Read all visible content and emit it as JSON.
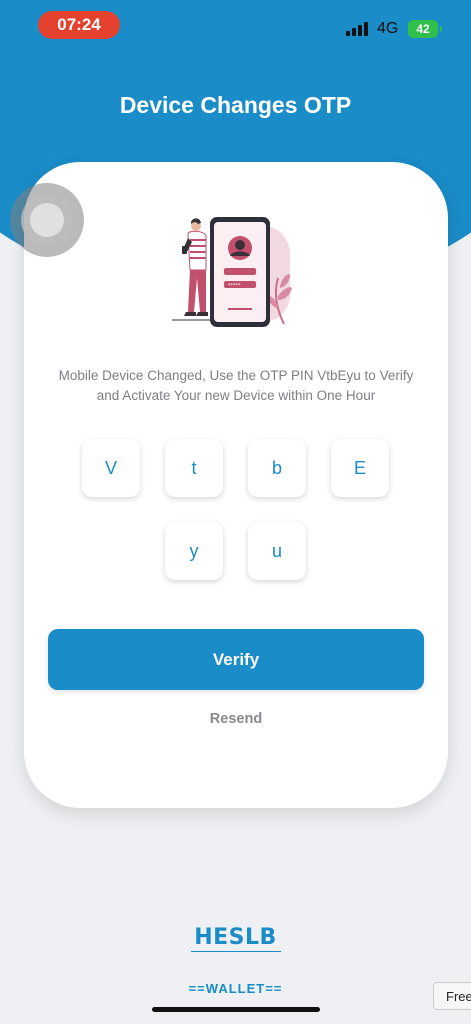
{
  "status_bar": {
    "time": "07:24",
    "network": "4G",
    "battery": "42"
  },
  "page": {
    "title": "Device Changes OTP"
  },
  "card": {
    "message": "Mobile Device Changed, Use the OTP PIN VtbEyu to Verify and Activate Your new Device within One Hour",
    "otp_digits": [
      "V",
      "t",
      "b",
      "E",
      "y",
      "u"
    ],
    "verify_label": "Verify",
    "resend_label": "Resend"
  },
  "footer": {
    "logo_text": "HESLB",
    "wallet_label": "==WALLET==",
    "free_tab_label": "Free"
  },
  "colors": {
    "brand": "#1a8cc8",
    "time_pill": "#e5412f",
    "battery": "#2fbf4a"
  },
  "icons": {
    "illustration": "person-with-phone-illustration",
    "assistive_touch": "assistive-touch-icon"
  }
}
